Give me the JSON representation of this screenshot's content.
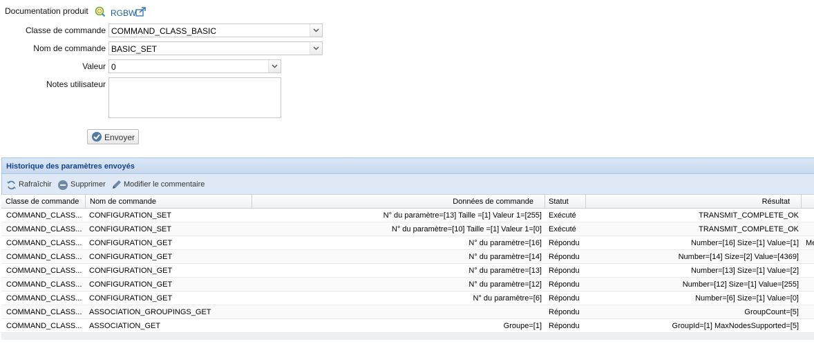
{
  "product_doc": {
    "label": "Documentation produit",
    "link": "RGBW"
  },
  "form": {
    "command_class_label": "Classe de commande",
    "command_class_value": "COMMAND_CLASS_BASIC",
    "command_name_label": "Nom de commande",
    "command_name_value": "BASIC_SET",
    "value_label": "Valeur",
    "value_value": "0",
    "notes_label": "Notes utilisateur",
    "notes_value": "",
    "send_label": "Envoyer"
  },
  "history": {
    "title": "Historique des paramètres envoyés",
    "toolbar": {
      "refresh": "Rafraîchir",
      "delete": "Supprimer",
      "edit_comment": "Modifier le commentaire"
    },
    "columns": {
      "command_class": "Classe de commande",
      "command_name": "Nom de commande",
      "command_data": "Données de commande",
      "status": "Statut",
      "result": "Résultat"
    },
    "rows": [
      {
        "cls": "COMMAND_CLASS...",
        "name": "CONFIGURATION_SET",
        "data": "N° du paramètre=[13] Taille =[1] Valeur 1=[255]",
        "status": "Exécuté",
        "result": "TRANSMIT_COMPLETE_OK",
        "extra": ""
      },
      {
        "cls": "COMMAND_CLASS...",
        "name": "CONFIGURATION_SET",
        "data": "N° du paramètre=[10] Taille =[1] Valeur 1=[0]",
        "status": "Exécuté",
        "result": "TRANSMIT_COMPLETE_OK",
        "extra": ""
      },
      {
        "cls": "COMMAND_CLASS...",
        "name": "CONFIGURATION_GET",
        "data": "N° du paramètre=[16]",
        "status": "Répondu",
        "result": "Number=[16] Size=[1] Value=[1]",
        "extra": "Me"
      },
      {
        "cls": "COMMAND_CLASS...",
        "name": "CONFIGURATION_GET",
        "data": "N° du paramètre=[14]",
        "status": "Répondu",
        "result": "Number=[14] Size=[2] Value=[4369]",
        "extra": ""
      },
      {
        "cls": "COMMAND_CLASS...",
        "name": "CONFIGURATION_GET",
        "data": "N° du paramètre=[13]",
        "status": "Répondu",
        "result": "Number=[13] Size=[1] Value=[2]",
        "extra": ""
      },
      {
        "cls": "COMMAND_CLASS...",
        "name": "CONFIGURATION_GET",
        "data": "N° du paramètre=[12]",
        "status": "Répondu",
        "result": "Number=[12] Size=[1] Value=[255]",
        "extra": ""
      },
      {
        "cls": "COMMAND_CLASS...",
        "name": "CONFIGURATION_GET",
        "data": "N° du paramètre=[6]",
        "status": "Répondu",
        "result": "Number=[6] Size=[1] Value=[0]",
        "extra": ""
      },
      {
        "cls": "COMMAND_CLASS...",
        "name": "ASSOCIATION_GROUPINGS_GET",
        "data": "",
        "status": "Répondu",
        "result": "GroupCount=[5]",
        "extra": ""
      },
      {
        "cls": "COMMAND_CLASS...",
        "name": "ASSOCIATION_GET",
        "data": "Groupe=[1]",
        "status": "Répondu",
        "result": "GroupId=[1] MaxNodesSupported=[5]",
        "extra": ""
      }
    ]
  }
}
